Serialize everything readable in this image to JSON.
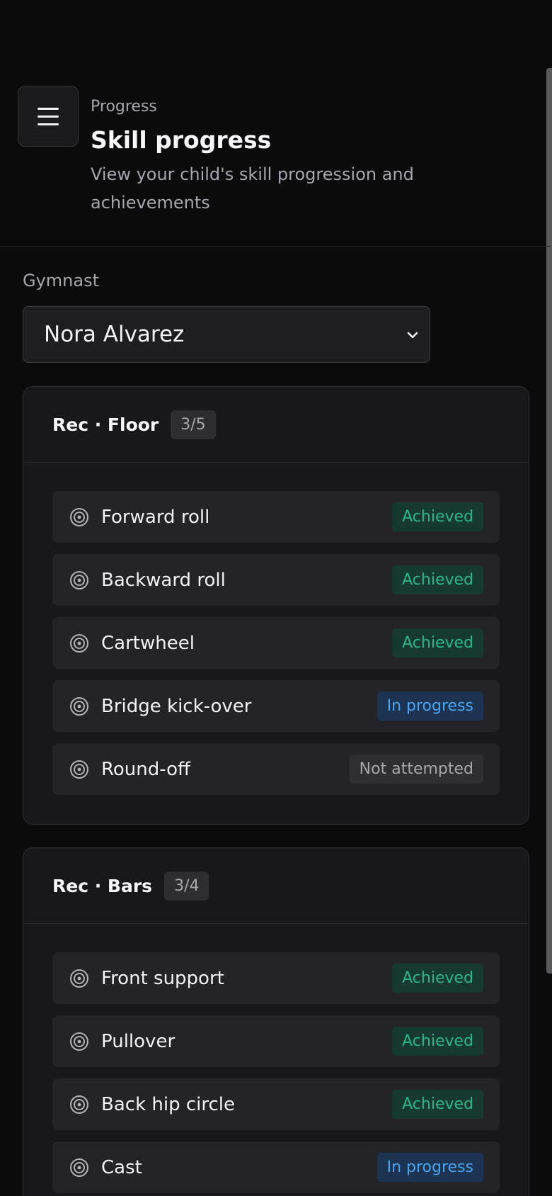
{
  "header": {
    "eyebrow": "Progress",
    "title": "Skill progress",
    "subtitle": "View your child's skill progression and achievements"
  },
  "gymnast": {
    "label": "Gymnast",
    "selected": "Nora Alvarez"
  },
  "categories": [
    {
      "title": "Rec · Floor",
      "count": "3/5",
      "skills": [
        {
          "name": "Forward roll",
          "status": "Achieved"
        },
        {
          "name": "Backward roll",
          "status": "Achieved"
        },
        {
          "name": "Cartwheel",
          "status": "Achieved"
        },
        {
          "name": "Bridge kick-over",
          "status": "In progress"
        },
        {
          "name": "Round-off",
          "status": "Not attempted"
        }
      ]
    },
    {
      "title": "Rec · Bars",
      "count": "3/4",
      "skills": [
        {
          "name": "Front support",
          "status": "Achieved"
        },
        {
          "name": "Pullover",
          "status": "Achieved"
        },
        {
          "name": "Back hip circle",
          "status": "Achieved"
        },
        {
          "name": "Cast",
          "status": "In progress"
        }
      ]
    }
  ],
  "colors": {
    "achieved": "#2bb585",
    "in_progress": "#4aa3ef",
    "not_attempted": "#a6a6ad"
  },
  "icons": {
    "menu": "hamburger-menu-icon",
    "skill": "target-icon",
    "select": "chevron-down-icon"
  }
}
